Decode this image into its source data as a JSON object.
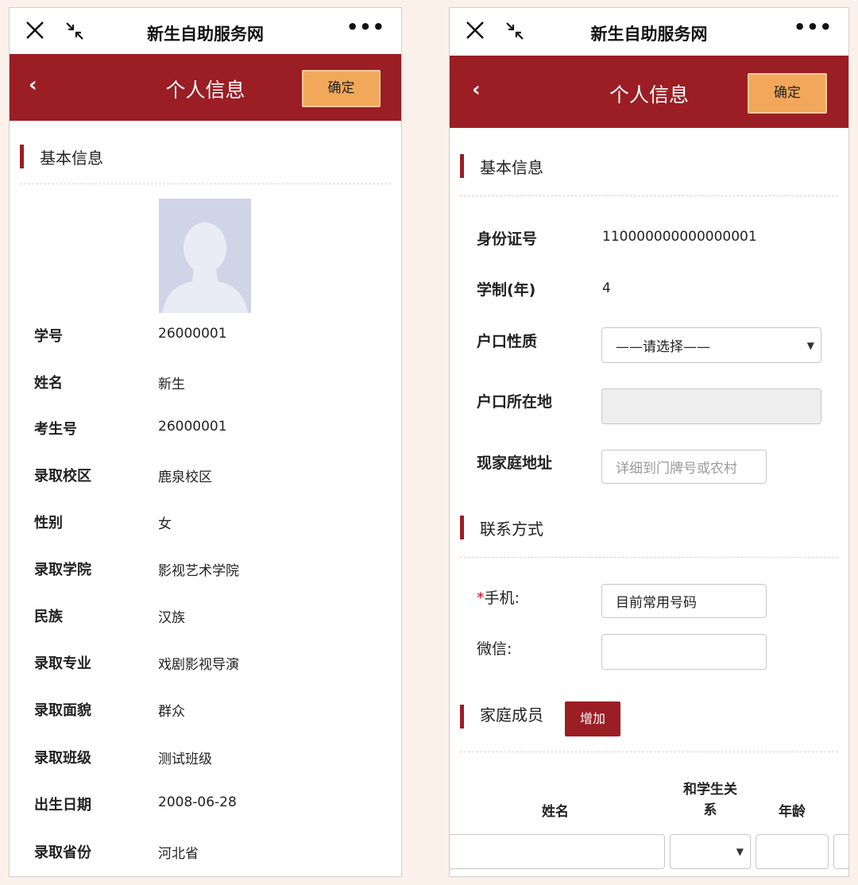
{
  "wechat": {
    "title": "新生自助服务网",
    "more": "•••"
  },
  "header": {
    "title": "个人信息",
    "confirm_label": "确定",
    "back": "‹"
  },
  "left": {
    "section": "基本信息",
    "fields": [
      {
        "label": "学号",
        "value": "26000001"
      },
      {
        "label": "姓名",
        "value": "新生"
      },
      {
        "label": "考生号",
        "value": "26000001"
      },
      {
        "label": "录取校区",
        "value": "鹿泉校区"
      },
      {
        "label": "性别",
        "value": "女"
      },
      {
        "label": "录取学院",
        "value": "影视艺术学院"
      },
      {
        "label": "民族",
        "value": "汉族"
      },
      {
        "label": "录取专业",
        "value": "戏剧影视导演"
      },
      {
        "label": "录取面貌",
        "value": "群众"
      },
      {
        "label": "录取班级",
        "value": "测试班级"
      },
      {
        "label": "出生日期",
        "value": "2008-06-28"
      },
      {
        "label": "录取省份",
        "value": "河北省"
      }
    ]
  },
  "right": {
    "section_basic": "基本信息",
    "id_label": "身份证号",
    "id_value": "110000000000000001",
    "duration_label": "学制(年)",
    "duration_value": "4",
    "hukou_type_label": "户口性质",
    "hukou_type_selected": "——请选择——",
    "hukou_loc_label": "户口所在地",
    "hukou_loc_value": "",
    "address_label": "现家庭地址",
    "address_placeholder": "详细到门牌号或农村",
    "section_contact": "联系方式",
    "phone_required": "*",
    "phone_label": "手机:",
    "phone_value": "目前常用号码",
    "wechat_label": "微信:",
    "wechat_value": "",
    "section_family": "家庭成员",
    "add_label": "增加",
    "table_headers": {
      "name": "姓名",
      "relation_line1": "和学生关",
      "relation_line2": "系",
      "age": "年龄"
    }
  }
}
